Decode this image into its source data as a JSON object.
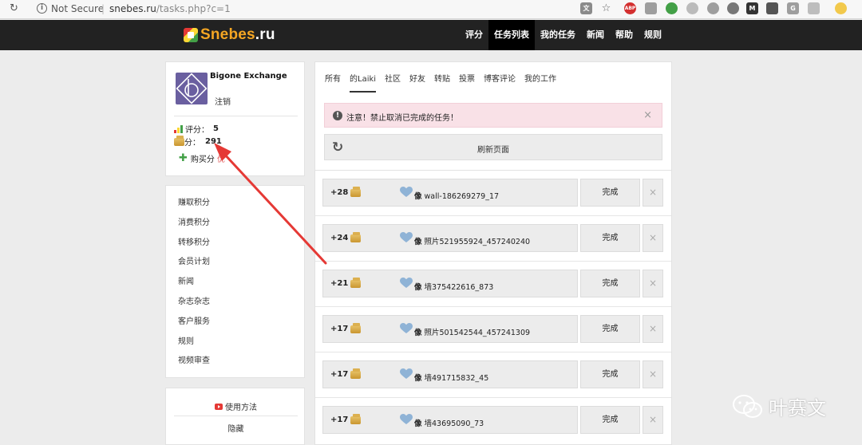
{
  "browser": {
    "security": "Not Secure",
    "url_host": "snebes.ru",
    "url_path": "/tasks.php?c=1",
    "extension_labels": [
      "ABP"
    ]
  },
  "header": {
    "logo_main": "Snebes",
    "logo_tld": ".ru",
    "nav": [
      "评分",
      "任务列表",
      "我的任务",
      "新闻",
      "帮助",
      "规则"
    ],
    "active_nav": "任务列表",
    "brand_color": "#f5a623",
    "bar_color": "#222222"
  },
  "profile": {
    "name": "Bigone Exchange",
    "logout": "注销",
    "rating_label": "评分：",
    "rating_value": "5",
    "points_label": "分：",
    "points_value": "291",
    "buy_label": "购买分",
    "buy_extra": "优"
  },
  "menu": [
    "赚取积分",
    "消费积分",
    "转移积分",
    "会员计划",
    "新闻",
    "杂志杂志",
    "客户服务",
    "规则",
    "视频审查"
  ],
  "help": {
    "usage": "使用方法",
    "hide": "隐藏"
  },
  "tabs": [
    "所有",
    "的Laiki",
    "社区",
    "好友",
    "转贴",
    "投票",
    "博客评论",
    "我的工作"
  ],
  "active_tab": "的Laiki",
  "alert": {
    "text": "注意！禁止取消已完成的任务！",
    "close": "×"
  },
  "refresh_label": "刷新页面",
  "tasks": [
    {
      "points": "+28",
      "prefix": "像",
      "name": "wall-186269279_17",
      "action": "完成",
      "close": "×"
    },
    {
      "points": "+24",
      "prefix": "像",
      "name": "照片521955924_457240240",
      "action": "完成",
      "close": "×"
    },
    {
      "points": "+21",
      "prefix": "像",
      "name": "墙375422616_873",
      "action": "完成",
      "close": "×"
    },
    {
      "points": "+17",
      "prefix": "像",
      "name": "照片501542544_457241309",
      "action": "完成",
      "close": "×"
    },
    {
      "points": "+17",
      "prefix": "像",
      "name": "墙491715832_45",
      "action": "完成",
      "close": "×"
    },
    {
      "points": "+17",
      "prefix": "像",
      "name": "墙43695090_73",
      "action": "完成",
      "close": "×"
    }
  ],
  "watermark": "叶赛文",
  "annotation_arrow_color": "#e53935"
}
